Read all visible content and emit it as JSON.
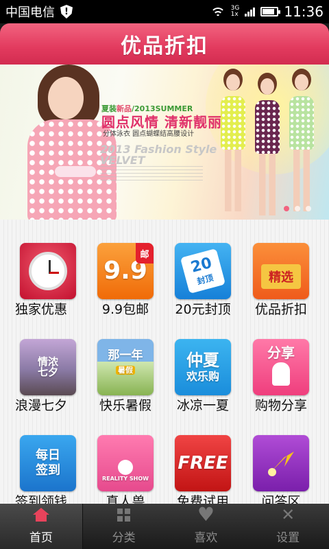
{
  "status_bar": {
    "carrier": "中国电信",
    "time": "11:36",
    "network_top": "3G",
    "network_bottom": "1x"
  },
  "header": {
    "title": "优品折扣"
  },
  "banner": {
    "tag_line_prefix": "夏装",
    "tag_line_highlight": "新品",
    "tag_line_suffix": "/2013SUMMER",
    "headline": "圆点风情 清新靓丽",
    "subline": "分体泳衣 圆点蝴蝶结高腰设计",
    "fashion_line1": "2013 Fashion Style",
    "fashion_line2": "VELVET"
  },
  "grid": [
    {
      "label": "独家优惠",
      "icon": "alarm-clock-icon"
    },
    {
      "label": "9.9包邮",
      "icon": "nine-nine-icon",
      "art": "9.9",
      "badge": "邮"
    },
    {
      "label": "20元封顶",
      "icon": "price-tag-icon",
      "art_top": "20",
      "art_bottom": "封顶"
    },
    {
      "label": "优品折扣",
      "icon": "gift-crate-icon",
      "art": "精选"
    },
    {
      "label": "浪漫七夕",
      "icon": "couple-icon",
      "art": "情浓七夕"
    },
    {
      "label": "快乐暑假",
      "icon": "summer-holiday-icon",
      "art_top": "那一年",
      "art_bottom": "暑假"
    },
    {
      "label": "冰凉一夏",
      "icon": "umbrella-icon",
      "art_top": "仲夏",
      "art_bottom": "欢乐购"
    },
    {
      "label": "购物分享",
      "icon": "shopping-bags-icon",
      "art": "分享"
    },
    {
      "label": "签到领钱",
      "icon": "sign-in-icon",
      "art_top": "每日",
      "art_bottom": "签到"
    },
    {
      "label": "真人兽",
      "icon": "reality-show-icon",
      "art": "REALITY SHOW"
    },
    {
      "label": "免费试用",
      "icon": "free-icon",
      "art": "FREE"
    },
    {
      "label": "问答区",
      "icon": "arrow-star-icon"
    }
  ],
  "tabs": [
    {
      "label": "首页",
      "icon": "home-icon",
      "active": true
    },
    {
      "label": "分类",
      "icon": "grid-icon",
      "active": false
    },
    {
      "label": "喜欢",
      "icon": "heart-icon",
      "active": false
    },
    {
      "label": "设置",
      "icon": "tools-icon",
      "active": false
    }
  ],
  "colors": {
    "header": "#e23a5e",
    "active_tab_text": "#ffffff",
    "inactive_tab_text": "#8c8c8c"
  }
}
